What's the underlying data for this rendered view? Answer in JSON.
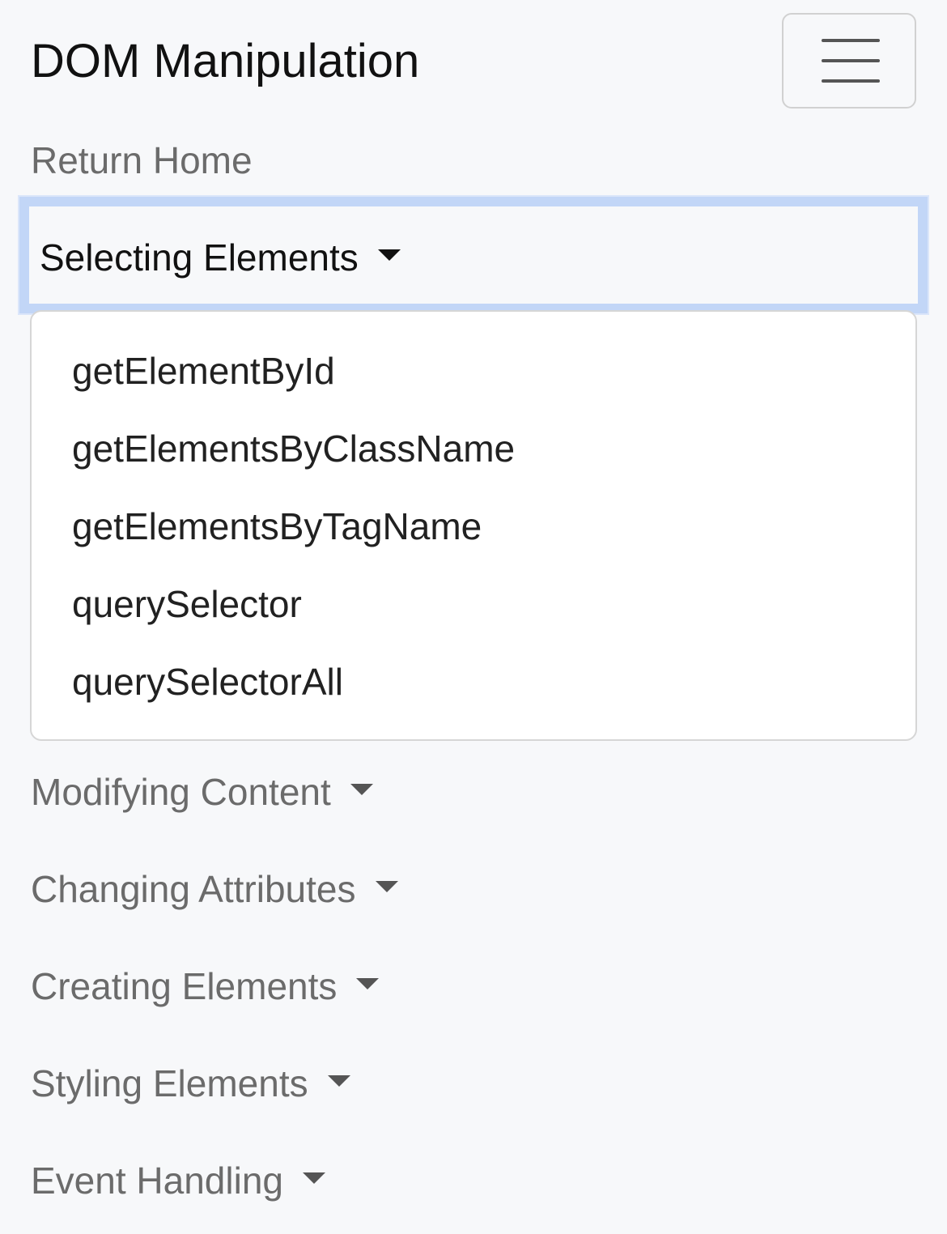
{
  "navbar": {
    "brand": "DOM Manipulation",
    "toggler_icon": "hamburger-menu-icon",
    "home_link": "Return Home",
    "dropdowns": [
      {
        "label": "Selecting Elements",
        "expanded": true,
        "items": [
          "getElementById",
          "getElementsByClassName",
          "getElementsByTagName",
          "querySelector",
          "querySelectorAll"
        ]
      },
      {
        "label": "Modifying Content",
        "expanded": false
      },
      {
        "label": "Changing Attributes",
        "expanded": false
      },
      {
        "label": "Creating Elements",
        "expanded": false
      },
      {
        "label": "Styling Elements",
        "expanded": false
      },
      {
        "label": "Event Handling",
        "expanded": false
      }
    ]
  },
  "colors": {
    "background": "#f7f8fa",
    "focus_ring": "#c2d6f7",
    "link_muted": "#6b6b6b",
    "text_dark": "#111111",
    "menu_bg": "#ffffff"
  }
}
